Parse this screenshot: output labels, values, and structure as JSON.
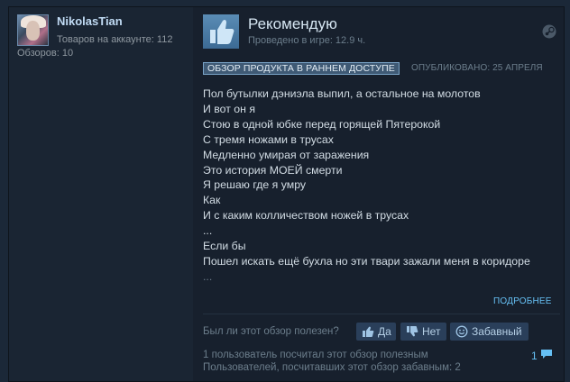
{
  "author": {
    "name": "NikolasTian",
    "products_owned": "Товаров на аккаунте: 112",
    "reviews_count": "Обзоров: 10"
  },
  "review": {
    "verdict": "Рекомендую",
    "playtime": "Проведено в игре: 12.9 ч.",
    "early_access_badge": "ОБЗОР ПРОДУКТА В РАННЕМ ДОСТУПЕ",
    "posted_date": "ОПУБЛИКОВАНО: 25 АПРЕЛЯ",
    "lines": [
      "Пол бутылки дэниэла выпил, а остальное на молотов",
      "И вот он я",
      "Стою в одной юбке перед горящей Пятерокой",
      "С тремя ножами в трусах",
      "Медленно умирая от заражения",
      "Это история МОЕЙ смерти",
      "Я решаю где я умру",
      "Как",
      "И с каким колличеством ножей в трусах",
      "...",
      "Если бы",
      "Пошел искать ещё бухла но эти твари зажали меня в коридоре",
      "..."
    ],
    "read_more": "ПОДРОБНЕЕ"
  },
  "feedback": {
    "question": "Был ли этот обзор полезен?",
    "yes_label": "Да",
    "no_label": "Нет",
    "funny_label": "Забавный",
    "helpful_stat": "1 пользователь посчитал этот обзор полезным",
    "funny_stat": "Пользователей, посчитавших этот обзор забавным: 2",
    "comment_count": "1"
  },
  "icons": {
    "thumb": "thumbs-up-icon",
    "platform": "steam-icon",
    "yes": "thumbs-up-icon",
    "no": "thumbs-down-icon",
    "funny": "smiley-icon",
    "comments": "comment-icon"
  },
  "colors": {
    "accent": "#66c0f4",
    "background": "#1b2838",
    "badge": "#3f5a75"
  }
}
